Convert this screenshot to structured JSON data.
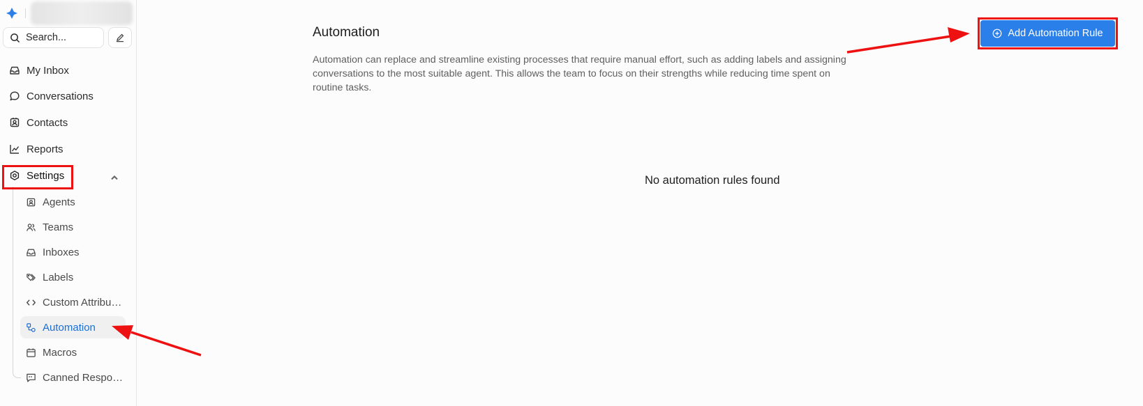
{
  "sidebar": {
    "search": {
      "placeholder": "Search..."
    },
    "nav": [
      {
        "label": "My Inbox",
        "icon": "inbox-icon"
      },
      {
        "label": "Conversations",
        "icon": "chat-bubble-icon"
      },
      {
        "label": "Contacts",
        "icon": "contact-card-icon"
      },
      {
        "label": "Reports",
        "icon": "line-chart-icon"
      },
      {
        "label": "Settings",
        "icon": "settings-gear-icon",
        "expanded": true
      }
    ],
    "settings_items": [
      {
        "label": "Agents",
        "icon": "agent-icon"
      },
      {
        "label": "Teams",
        "icon": "team-icon"
      },
      {
        "label": "Inboxes",
        "icon": "inbox-icon"
      },
      {
        "label": "Labels",
        "icon": "tags-icon"
      },
      {
        "label": "Custom Attributes",
        "icon": "code-icon"
      },
      {
        "label": "Automation",
        "icon": "automation-icon",
        "active": true
      },
      {
        "label": "Macros",
        "icon": "calendar-icon"
      },
      {
        "label": "Canned Responses",
        "icon": "canned-response-icon"
      }
    ]
  },
  "main": {
    "title": "Automation",
    "description": "Automation can replace and streamline existing processes that require manual effort, such as adding labels and assigning conversations to the most suitable agent. This allows the team to focus on their strengths while reducing time spent on routine tasks.",
    "add_button_label": "Add Automation Rule",
    "empty_message": "No automation rules found"
  },
  "colors": {
    "accent": "#2b7fe8",
    "active_text": "#1a6fd6",
    "annotation_red": "#ee1111"
  }
}
